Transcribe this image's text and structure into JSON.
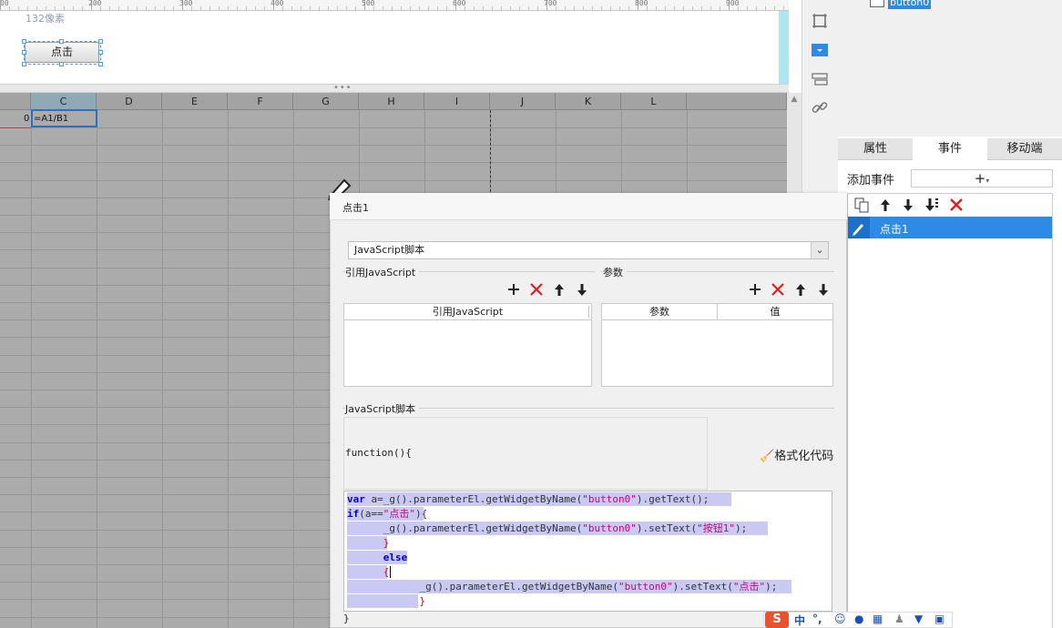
{
  "ruler": {
    "labels": [
      "200",
      "300",
      "400",
      "500",
      "600",
      "700",
      "800",
      "900"
    ]
  },
  "canvas": {
    "size_hint": "132像素",
    "widget_button_label": "点击"
  },
  "spreadsheet": {
    "columns": [
      "C",
      "D",
      "E",
      "F",
      "G",
      "H",
      "I",
      "J",
      "K",
      "L"
    ],
    "row_number": "0",
    "cell_formula": "=A1/B1"
  },
  "tree": {
    "node_label": "button0"
  },
  "right_panel": {
    "tabs": [
      "属性",
      "事件",
      "移动端"
    ],
    "active_tab": "事件",
    "add_event_label": "添加事件",
    "add_event_button": "+",
    "event_item": "点击1"
  },
  "dialog": {
    "title": "点击1",
    "type_select": "JavaScript脚本",
    "ref_js_section": "引用JavaScript",
    "params_section": "参数",
    "ref_js_column": "引用JavaScript",
    "param_col_name": "参数",
    "param_col_value": "值",
    "script_section": "JavaScript脚本",
    "function_header": "function(){",
    "format_code": "格式化代码",
    "closing_brace": "}",
    "code_lines": [
      "var a=_g().parameterEl.getWidgetByName(\"button0\").getText();",
      "if(a==\"点击\"){",
      "_g().parameterEl.getWidgetByName(\"button0\").setText(\"按钮1\");",
      "}",
      "else",
      "{",
      "_g().parameterEl.getWidgetByName(\"button0\").setText(\"点击\");",
      "}"
    ]
  },
  "ime": {
    "logo": "S",
    "mode": "中"
  },
  "colors": {
    "accent": "#2f8ae5",
    "delete_red": "#e02020",
    "grid_gray": "#ababab",
    "code_highlight": "#c9c9f3"
  }
}
